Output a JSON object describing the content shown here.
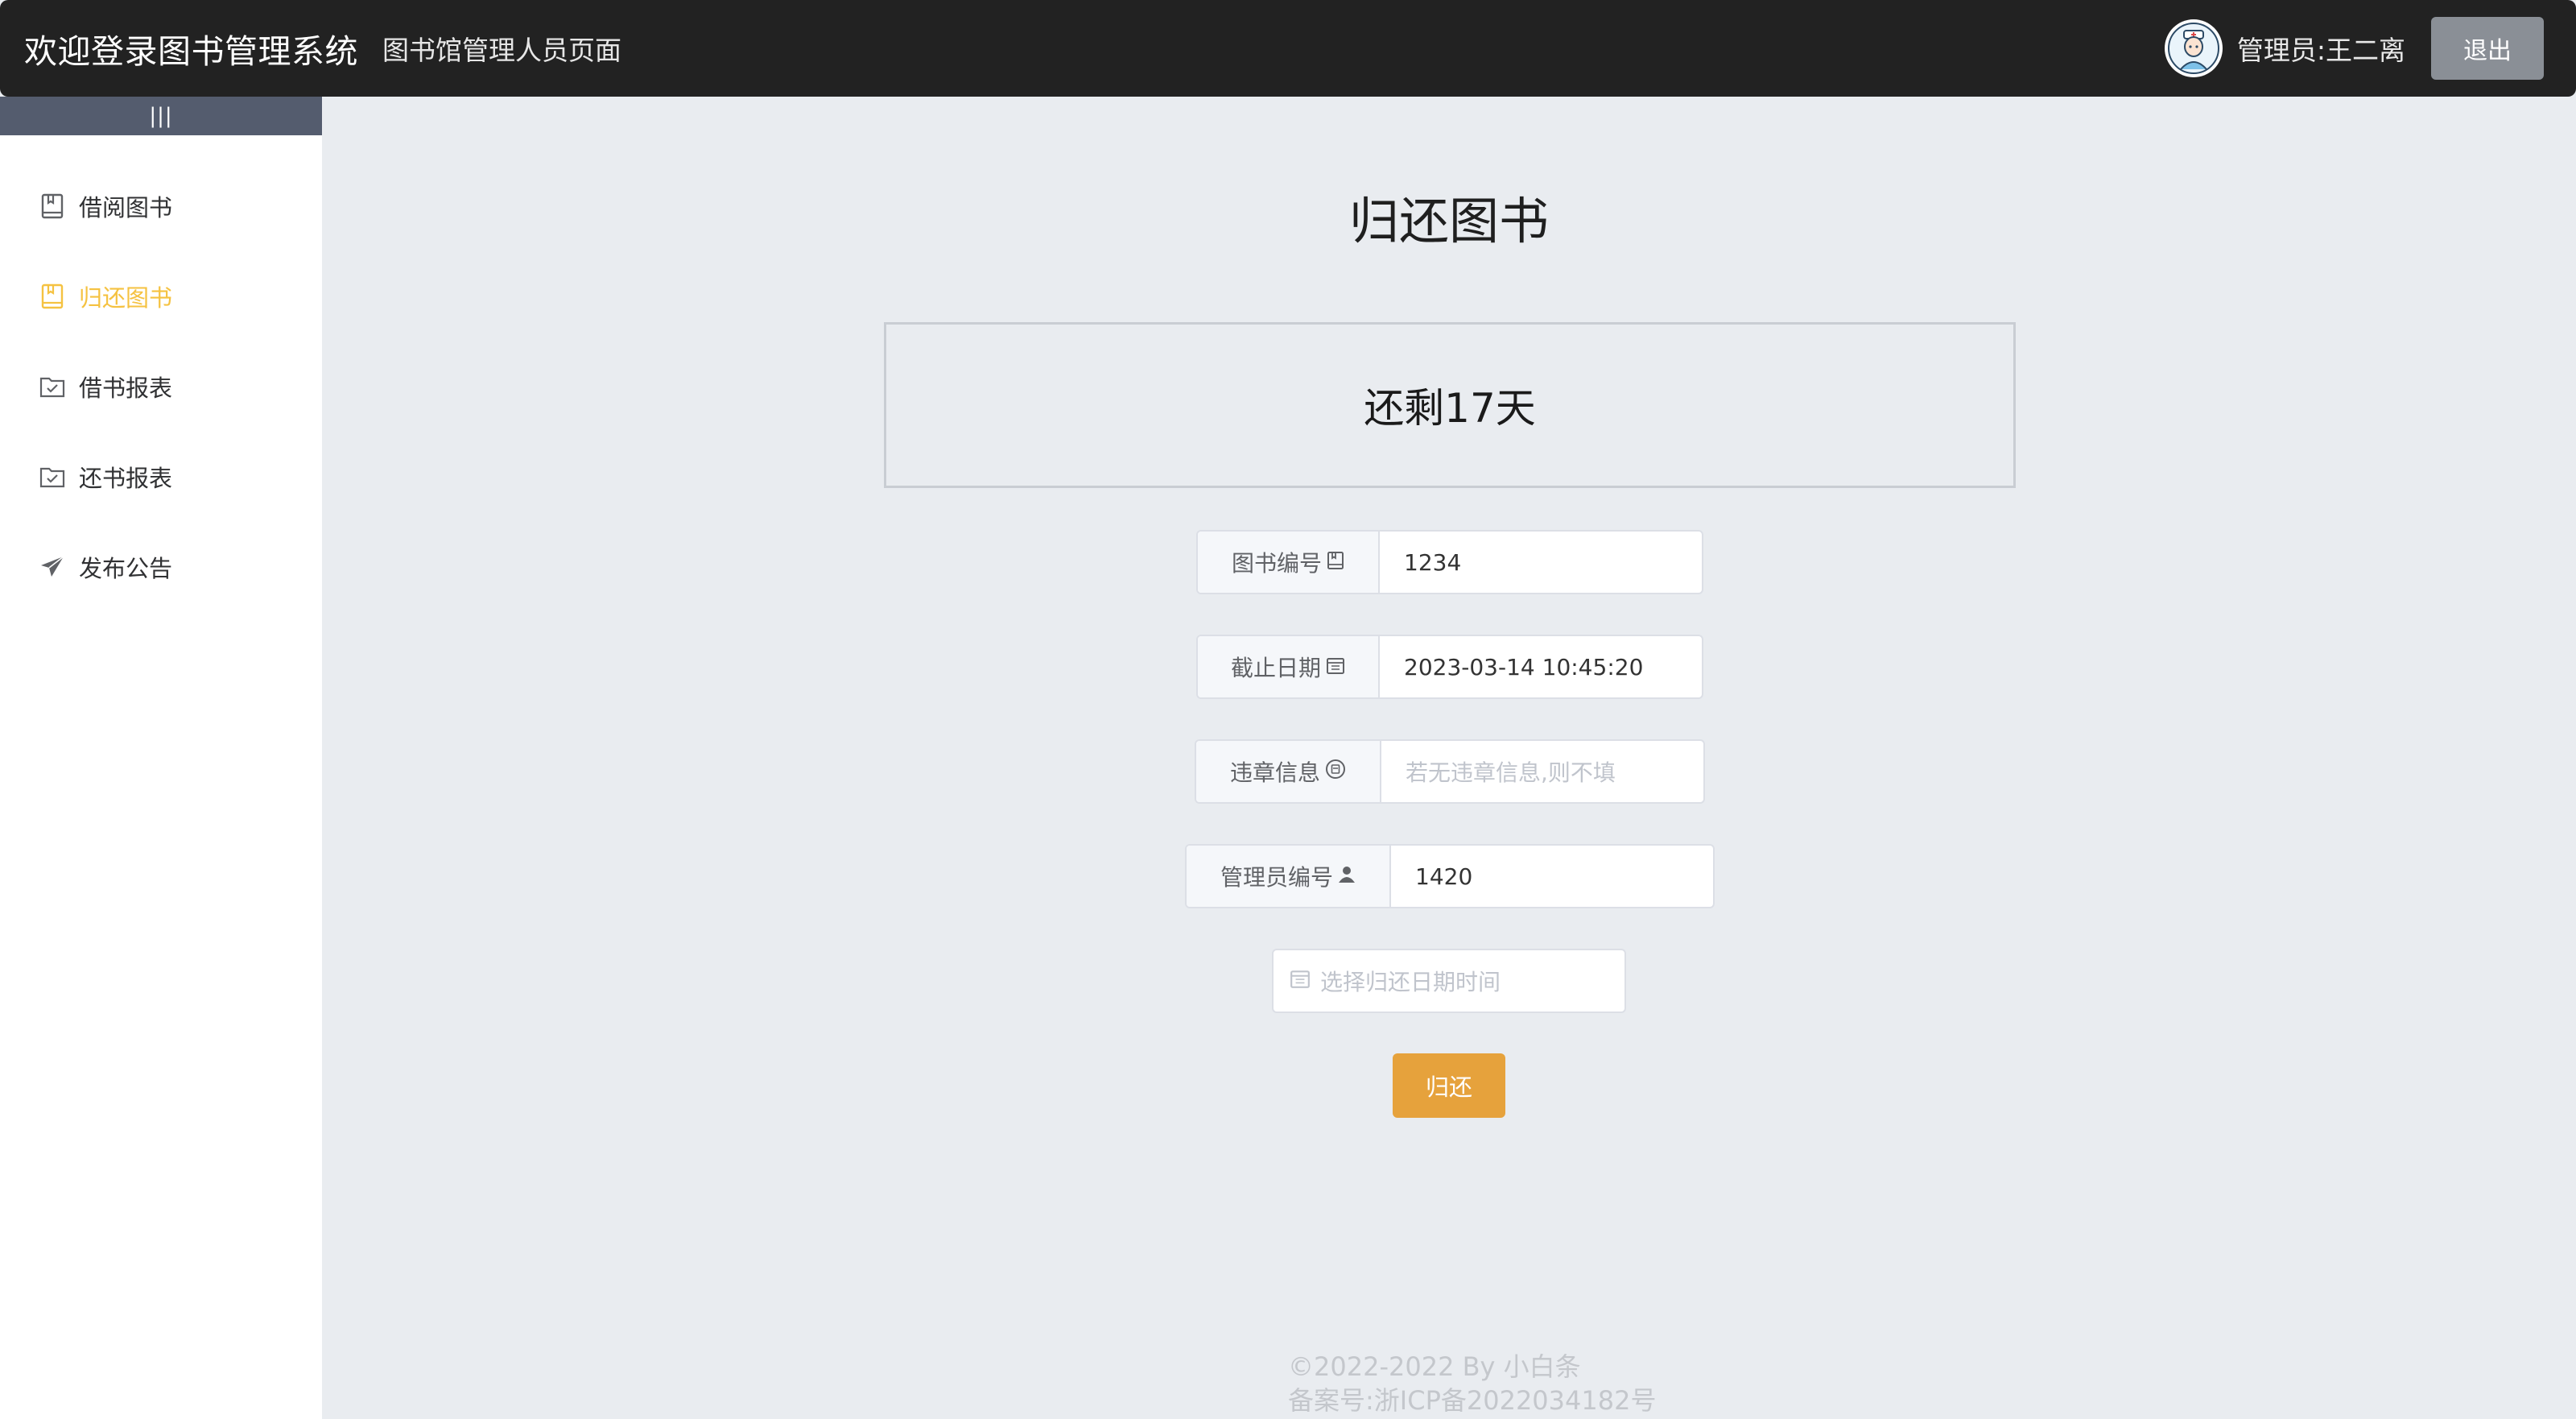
{
  "header": {
    "brand": "欢迎登录图书管理系统",
    "subtitle": "图书馆管理人员页面",
    "admin_label": "管理员:王二离",
    "logout_label": "退出"
  },
  "sidebar": {
    "toggle_label": "|||",
    "items": [
      {
        "label": "借阅图书",
        "icon": "book-icon",
        "active": false
      },
      {
        "label": "归还图书",
        "icon": "book-icon",
        "active": true
      },
      {
        "label": "借书报表",
        "icon": "folder-checked-icon",
        "active": false
      },
      {
        "label": "还书报表",
        "icon": "folder-checked-icon",
        "active": false
      },
      {
        "label": "发布公告",
        "icon": "send-icon",
        "active": false
      }
    ]
  },
  "main": {
    "title": "归还图书",
    "countdown": "还剩17天",
    "form": {
      "book_id": {
        "label": "图书编号",
        "value": "1234",
        "icon": "book-icon"
      },
      "due_date": {
        "label": "截止日期",
        "value": "2023-03-14 10:45:20",
        "icon": "calendar-icon"
      },
      "violation": {
        "label": "违章信息",
        "placeholder": "若无违章信息,则不填",
        "icon": "info-circle-icon"
      },
      "admin_id": {
        "label": "管理员编号",
        "value": "1420",
        "icon": "user-icon"
      },
      "return_date": {
        "placeholder": "选择归还日期时间",
        "icon": "calendar-icon"
      }
    },
    "submit_label": "归还"
  },
  "footer": {
    "copyright": "©2022-2022 By 小白条",
    "icp": "备案号:浙ICP备2022034182号"
  },
  "colors": {
    "header_bg": "#222222",
    "active_menu": "#f5c241",
    "submit_button": "#e6a23c",
    "main_bg": "#e9ecf0"
  }
}
